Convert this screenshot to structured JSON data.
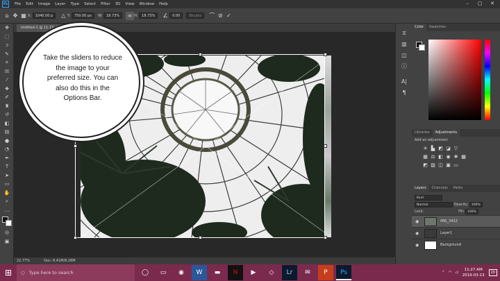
{
  "menubar": {
    "logo": "Ps",
    "items": [
      "File",
      "Edit",
      "Image",
      "Layer",
      "Type",
      "Select",
      "Filter",
      "3D",
      "View",
      "Window",
      "Help"
    ],
    "window_controls": [
      "–",
      "▢",
      "✕"
    ]
  },
  "options": {
    "x_label": "X:",
    "x_value": "1040.00 p",
    "y_label": "Y:",
    "y_value": "750.00 px",
    "w_label": "W:",
    "w_value": "18.73%",
    "h_label": "H:",
    "h_value": "18.73%",
    "angle_value": "0.00",
    "interp_label": "Bicubic",
    "cancel_icon": "cancel-icon",
    "commit_icon": "commit-icon"
  },
  "document": {
    "tab_title": "Untitled-1 @ 11.1% (Layer 1, RGB/8)"
  },
  "status": {
    "zoom": "22.77%",
    "doc": "Doc: 8.41M/8.26M"
  },
  "callout": {
    "text": "Take the sliders to reduce the image to your preferred size. You can also do this in the Options Bar."
  },
  "panels": {
    "color_tabs": [
      "Color",
      "Swatches"
    ],
    "adj_tabs": [
      "Libraries",
      "Adjustments"
    ],
    "adj_hint": "Add an adjustment",
    "layer_tabs": [
      "Layers",
      "Channels",
      "Paths"
    ],
    "kind": "Kind",
    "blend": "Normal",
    "opacity_label": "Opacity:",
    "opacity_value": "100%",
    "lock_label": "Lock:",
    "fill_label": "Fill:",
    "fill_value": "100%",
    "layers": [
      {
        "name": "IMG_3422",
        "selected": true
      },
      {
        "name": "Layer1",
        "selected": false
      },
      {
        "name": "Background",
        "selected": false
      }
    ]
  },
  "taskbar": {
    "search_placeholder": "Type here to search",
    "time": "11:27 AM",
    "date": "2019-03-13",
    "notif": "20"
  },
  "colors": {
    "taskbar": "#7a2b4d",
    "ps_accent": "#31a8ff"
  }
}
